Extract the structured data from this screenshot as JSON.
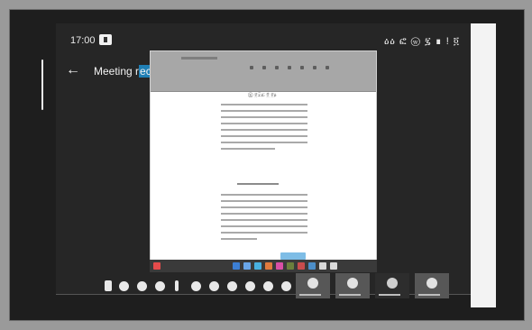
{
  "status_bar": {
    "time": "17:00",
    "right_text": "ዕዕ ፎ ⓦ ፯ ∎ ! ፬"
  },
  "header": {
    "back_icon": "arrow-left-icon",
    "title": "Meeting recording",
    "title_highlight_start": 9
  },
  "document": {
    "section_title": "Ⓡ ፱፰ፚ ፬ ፱ፅ",
    "submit_color": "#7ebde6"
  },
  "controls": [
    {
      "name": "mic-toggle-icon"
    },
    {
      "name": "video-toggle-icon"
    },
    {
      "name": "screen-share-icon"
    },
    {
      "name": "participants-icon"
    },
    {
      "name": "pen-icon"
    },
    {
      "name": "reactions-icon"
    },
    {
      "name": "chat-icon"
    },
    {
      "name": "record-icon"
    },
    {
      "name": "settings-icon"
    },
    {
      "name": "more-icon"
    },
    {
      "name": "leave-icon"
    }
  ],
  "participants": [
    {
      "name": "participant-1"
    },
    {
      "name": "participant-2"
    },
    {
      "name": "participant-3"
    },
    {
      "name": "participant-4"
    }
  ],
  "colors": {
    "background": "#1e1e1e",
    "highlight": "#1f7fb5"
  }
}
